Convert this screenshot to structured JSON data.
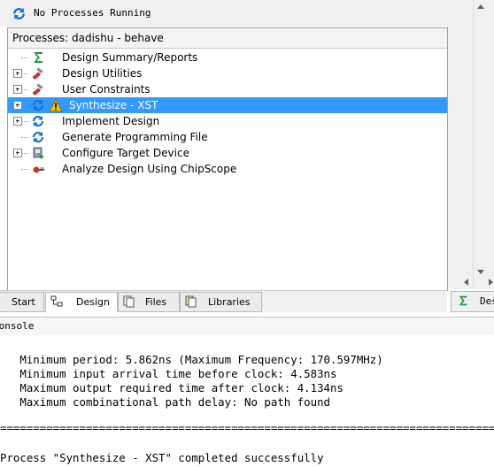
{
  "status": {
    "text": "No Processes Running"
  },
  "processes": {
    "header": "Processes: dadishu - behave",
    "items": [
      {
        "label": "Design Summary/Reports",
        "icon": "sigma-icon",
        "expandable": false,
        "selected": false,
        "warning": false
      },
      {
        "label": "Design Utilities",
        "icon": "tools-icon",
        "expandable": true,
        "selected": false,
        "warning": false
      },
      {
        "label": "User Constraints",
        "icon": "tools-icon",
        "expandable": true,
        "selected": false,
        "warning": false
      },
      {
        "label": "Synthesize - XST",
        "icon": "refresh-icon",
        "expandable": true,
        "selected": true,
        "warning": true
      },
      {
        "label": "Implement Design",
        "icon": "refresh-icon",
        "expandable": true,
        "selected": false,
        "warning": false
      },
      {
        "label": "Generate Programming File",
        "icon": "refresh-icon",
        "expandable": false,
        "selected": false,
        "warning": false
      },
      {
        "label": "Configure Target Device",
        "icon": "chip-icon",
        "expandable": true,
        "selected": false,
        "warning": false
      },
      {
        "label": "Analyze Design Using ChipScope",
        "icon": "probe-icon",
        "expandable": false,
        "selected": false,
        "warning": false
      }
    ]
  },
  "tabs": [
    {
      "label": "Start",
      "active": false
    },
    {
      "label": "Design",
      "active": true
    },
    {
      "label": "Files",
      "active": false
    },
    {
      "label": "Libraries",
      "active": false
    }
  ],
  "right_tab": {
    "label": "Des"
  },
  "console": {
    "header": "Console",
    "lines": [
      "   Minimum period: 5.862ns (Maximum Frequency: 170.597MHz)",
      "   Minimum input arrival time before clock: 4.583ns",
      "   Maximum output required time after clock: 4.134ns",
      "   Maximum combinational path delay: No path found"
    ],
    "separator": "===============================================================================",
    "final_line": "Process \"Synthesize - XST\" completed successfully"
  },
  "colors": {
    "selection": "#3399ff",
    "sigma_green": "#1a9a3a",
    "refresh_blue": "#1c6fd0",
    "warning_yellow": "#f5c400"
  }
}
